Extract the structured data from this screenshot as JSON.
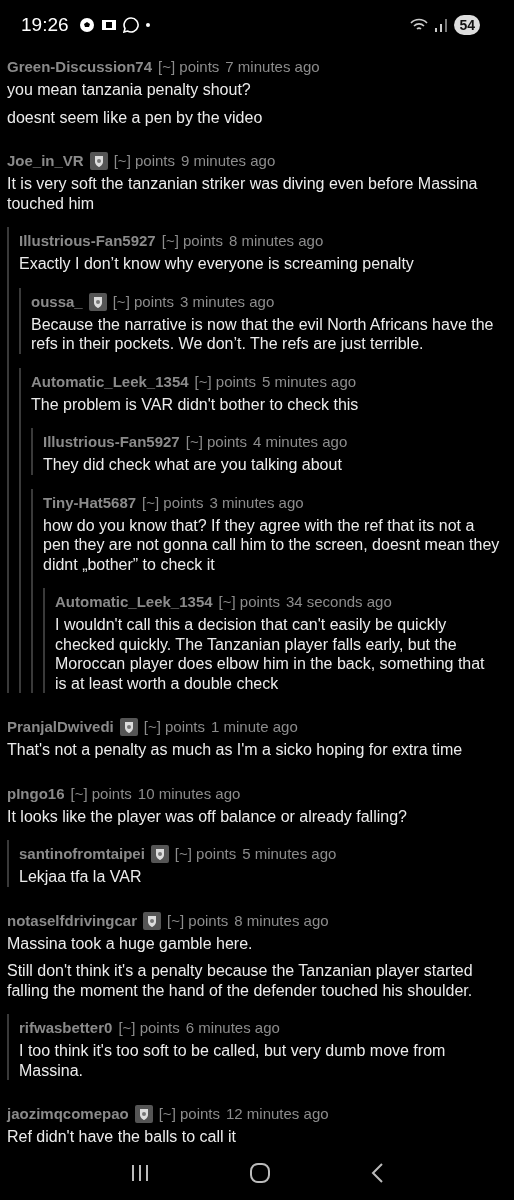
{
  "status_bar": {
    "time": "19:26",
    "battery": "54"
  },
  "comments": [
    {
      "author": "Green-Discussion74",
      "flair": false,
      "score": "[~] points",
      "time": "7 minutes ago",
      "paragraphs": [
        "you mean tanzania penalty shout?",
        "doesnt seem like a pen by the video"
      ]
    },
    {
      "author": "Joe_in_VR",
      "flair": true,
      "score": "[~] points",
      "time": "9 minutes ago",
      "paragraphs": [
        "It is very soft the tanzanian striker was diving even before Massina touched him"
      ],
      "children": [
        {
          "author": "Illustrious-Fan5927",
          "flair": false,
          "score": "[~] points",
          "time": "8 minutes ago",
          "paragraphs": [
            "Exactly I don’t know why everyone is screaming penalty"
          ],
          "children": [
            {
              "author": "oussa_",
              "flair": true,
              "score": "[~] points",
              "time": "3 minutes ago",
              "paragraphs": [
                "Because the narrative is now that the evil North Africans have the refs in their pockets. We don’t. The refs are just terrible."
              ]
            },
            {
              "author": "Automatic_Leek_1354",
              "flair": false,
              "score": "[~] points",
              "time": "5 minutes ago",
              "paragraphs": [
                "The problem is VAR didn't bother to check this"
              ],
              "children": [
                {
                  "author": "Illustrious-Fan5927",
                  "flair": false,
                  "score": "[~] points",
                  "time": "4 minutes ago",
                  "paragraphs": [
                    "They did check what are you talking about"
                  ]
                },
                {
                  "author": "Tiny-Hat5687",
                  "flair": false,
                  "score": "[~] points",
                  "time": "3 minutes ago",
                  "paragraphs": [
                    "how do you know that? If they agree with the ref that its not a pen they are not gonna call him to the screen, doesnt mean they didnt „bother” to check it"
                  ],
                  "children": [
                    {
                      "author": "Automatic_Leek_1354",
                      "flair": false,
                      "score": "[~] points",
                      "time": "34 seconds ago",
                      "paragraphs": [
                        "I wouldn't call this a decision that can't easily be quickly checked quickly. The Tanzanian player falls early, but the Moroccan player does elbow him in the back, something that is at least worth a double check"
                      ]
                    }
                  ]
                }
              ]
            }
          ]
        }
      ]
    },
    {
      "author": "PranjalDwivedi",
      "flair": true,
      "score": "[~] points",
      "time": "1 minute ago",
      "paragraphs": [
        "That's not a penalty as much as I'm a sicko hoping for extra time"
      ]
    },
    {
      "author": "pIngo16",
      "flair": false,
      "score": "[~] points",
      "time": "10 minutes ago",
      "paragraphs": [
        "It looks like the player was off balance or already falling?"
      ],
      "children": [
        {
          "author": "santinofromtaipei",
          "flair": true,
          "score": "[~] points",
          "time": "5 minutes ago",
          "paragraphs": [
            "Lekjaa tfa la VAR"
          ]
        }
      ]
    },
    {
      "author": "notaselfdrivingcar",
      "flair": true,
      "score": "[~] points",
      "time": "8 minutes ago",
      "paragraphs": [
        "Massina took a huge gamble here.",
        "Still don't think it's a penalty because the Tanzanian player started falling the moment the hand of the defender touched his shoulder."
      ],
      "children": [
        {
          "author": "rifwasbetter0",
          "flair": false,
          "score": "[~] points",
          "time": "6 minutes ago",
          "paragraphs": [
            "I too think it's too soft to be called, but very dumb move from Massina."
          ]
        }
      ]
    },
    {
      "author": "jaozimqcomepao",
      "flair": true,
      "score": "[~] points",
      "time": "12 minutes ago",
      "paragraphs": [
        "Ref didn't have the balls to call it"
      ]
    }
  ]
}
